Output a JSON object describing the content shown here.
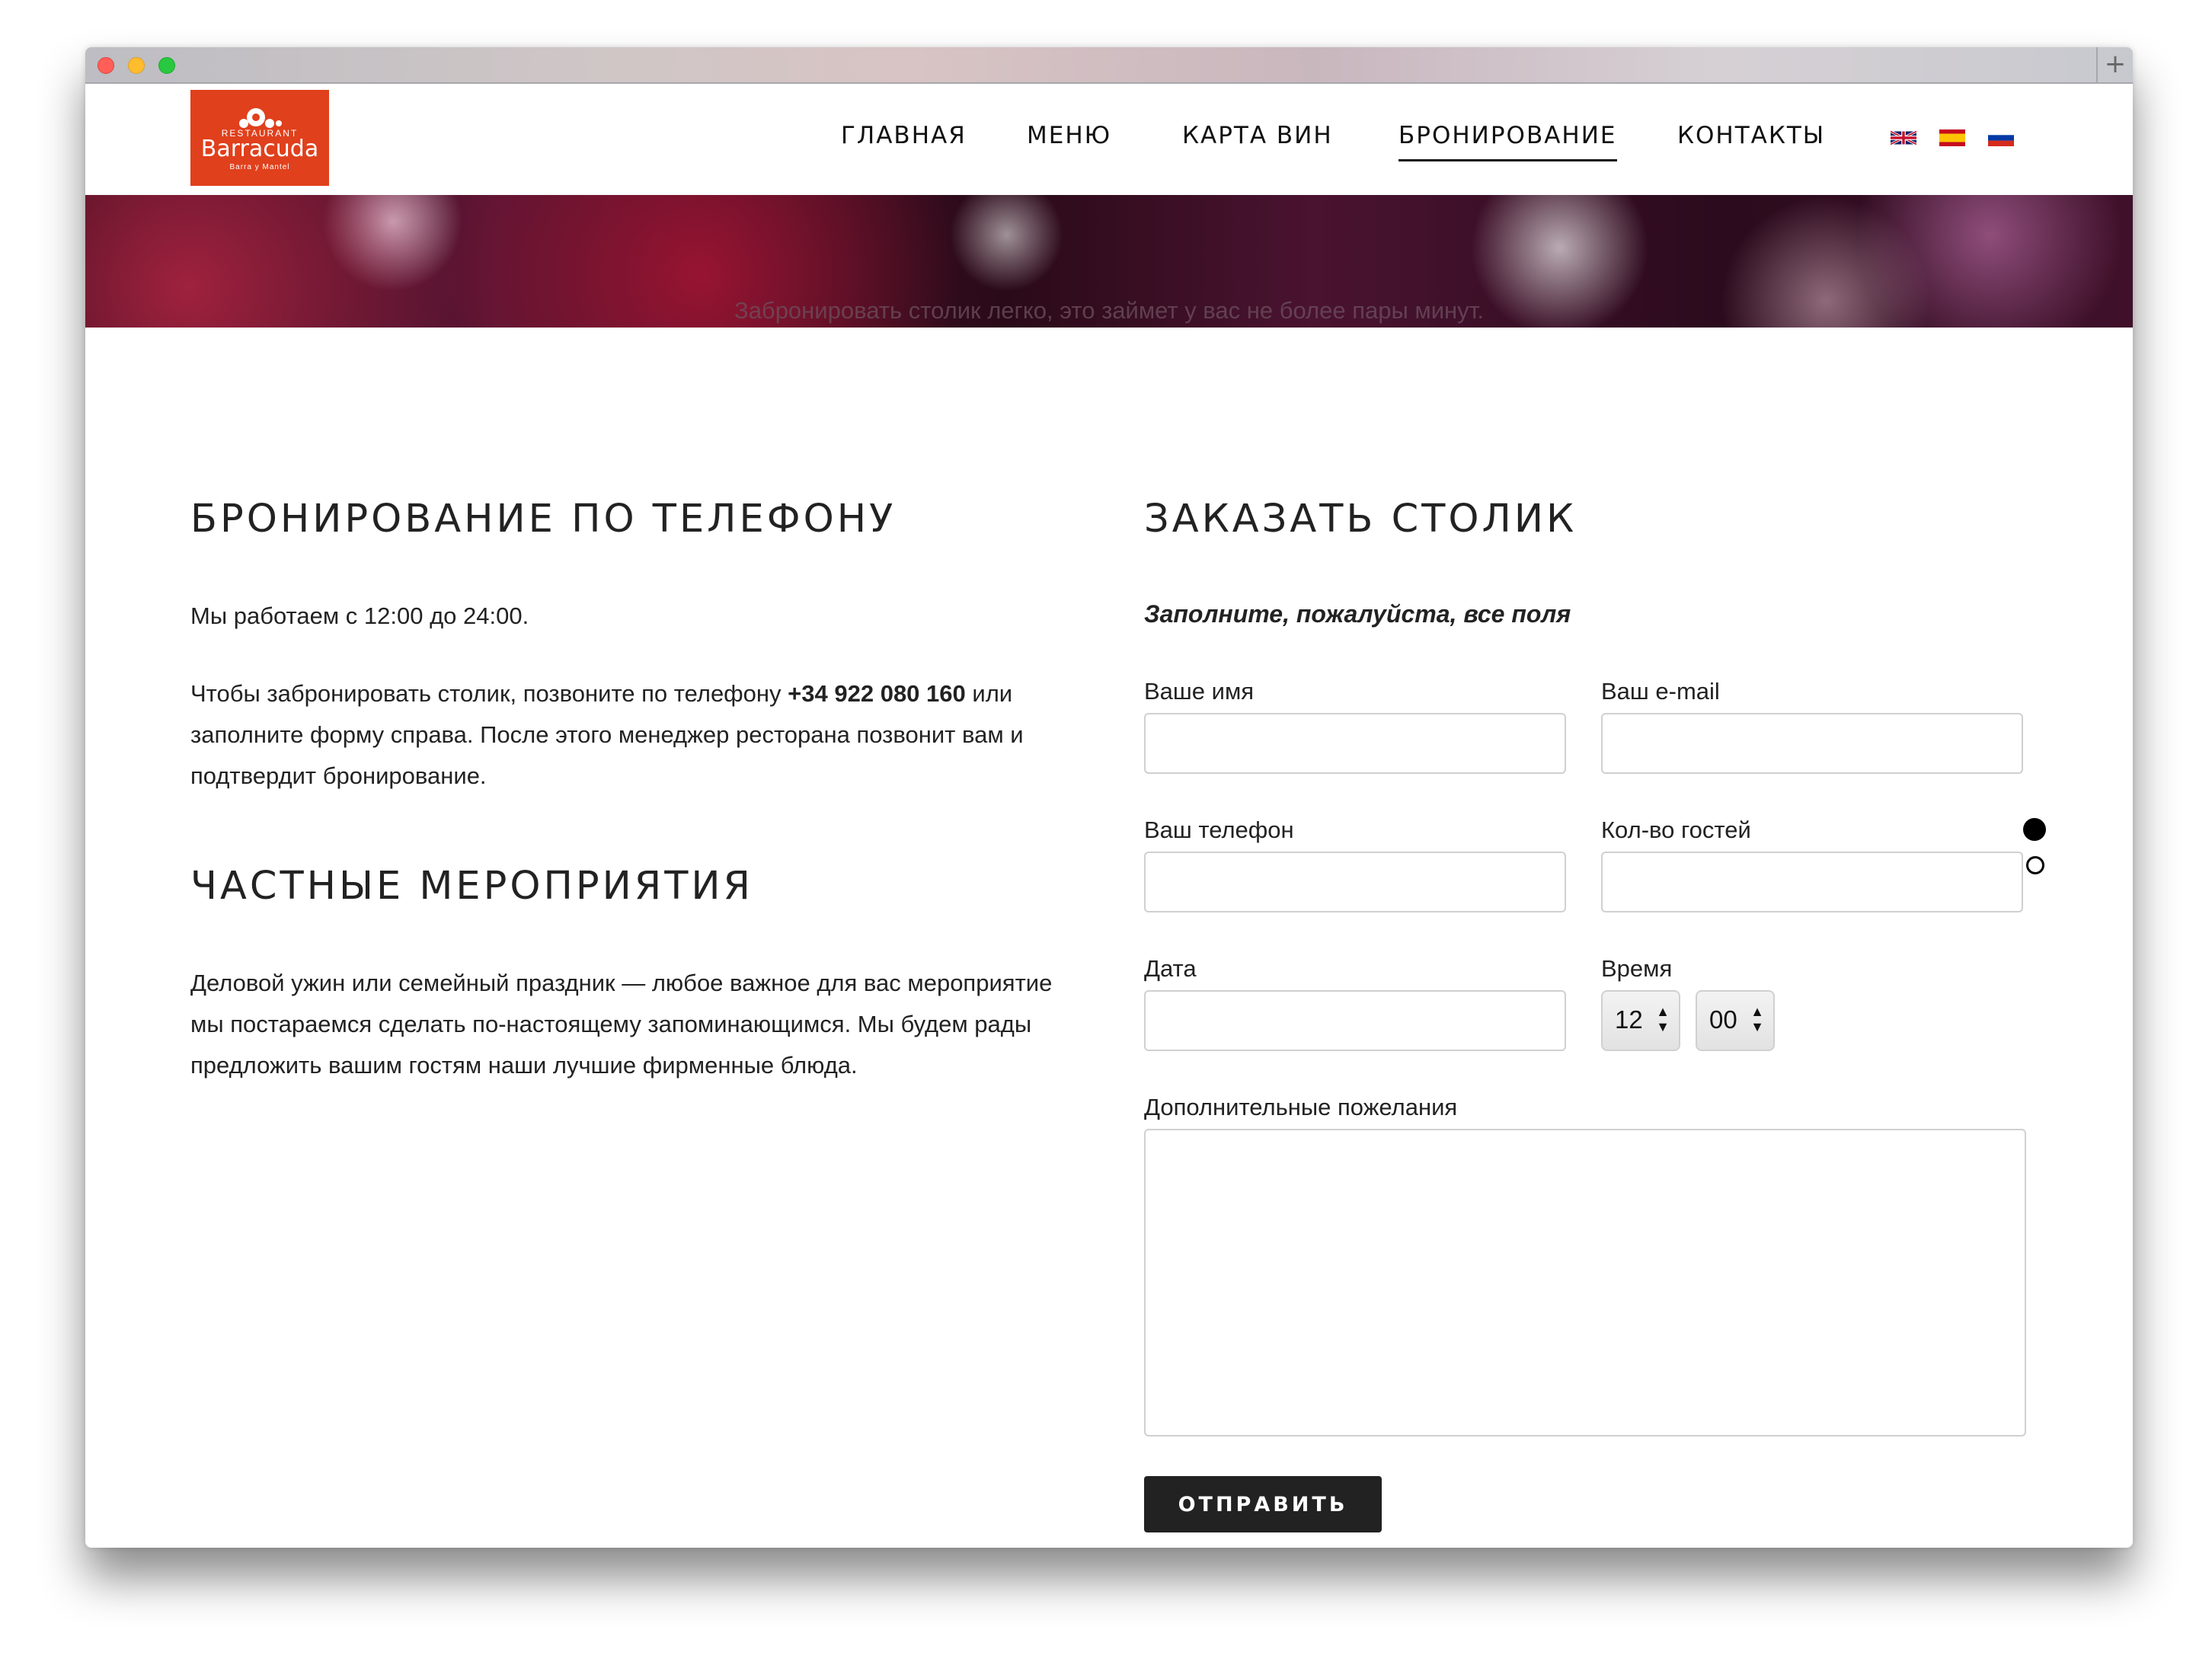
{
  "window": {
    "new_tab_symbol": "+"
  },
  "logo": {
    "small": "RESTAURANT",
    "name": "Barracuda",
    "sub": "Barra y Mantel"
  },
  "nav": {
    "items": [
      {
        "label": "ГЛАВНАЯ"
      },
      {
        "label": "МЕНЮ"
      },
      {
        "label": "КАРТА ВИН"
      },
      {
        "label": "БРОНИРОВАНИЕ",
        "active": true
      },
      {
        "label": "КОНТАКТЫ"
      }
    ],
    "flags": [
      "flag-uk-icon",
      "flag-spain-icon",
      "flag-russia-icon"
    ]
  },
  "banner": {
    "text": "Забронировать столик легко, это займет у вас не более пары минут."
  },
  "phone_section": {
    "title": "БРОНИРОВАНИЕ ПО ТЕЛЕФОНУ",
    "hours": "Мы работаем с 12:00 до 24:00.",
    "text_before": "Чтобы забронировать столик, позвоните по телефону ",
    "phone": "+34 922 080 160",
    "text_after": " или заполните форму справа. После этого менеджер ресторана позвонит вам и подтвердит бронирование."
  },
  "events_section": {
    "title": "ЧАСТНЫЕ МЕРОПРИЯТИЯ",
    "text": "Деловой ужин или семейный праздник — любое важное для вас мероприятие мы постараемся сделать по-настоящему запоминающимся. Мы будем рады предложить вашим гостям наши лучшие фирменные блюда."
  },
  "form": {
    "title": "ЗАКАЗАТЬ СТОЛИК",
    "note": "Заполните, пожалуйста, все поля",
    "name_label": "Ваше имя",
    "name_value": "",
    "email_label": "Ваш e-mail",
    "email_value": "",
    "phone_label": "Ваш телефон",
    "phone_value": "",
    "guests_label": "Кол-во гостей",
    "guests_value": "",
    "date_label": "Дата",
    "date_value": "",
    "time_label": "Время",
    "hour_value": "12",
    "minute_value": "00",
    "wishes_label": "Дополнительные пожелания",
    "wishes_value": "",
    "submit_label": "ОТПРАВИТЬ"
  },
  "colors": {
    "brand": "#e0401c",
    "button": "#222222",
    "text": "#222222"
  }
}
